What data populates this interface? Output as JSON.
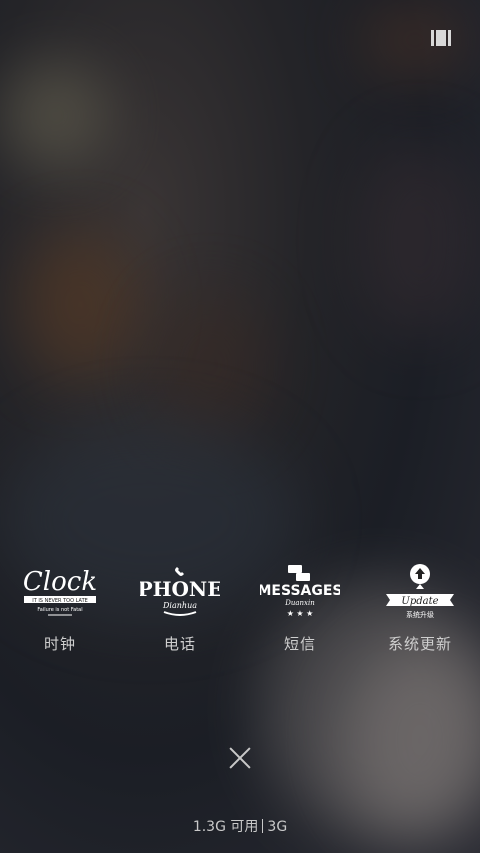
{
  "top_bar": {
    "icon": "card-switch-icon"
  },
  "apps": [
    {
      "name": "clock",
      "label": "时钟",
      "logo_text": "Clock",
      "logo_line1": "IT IS NEVER TOO LATE",
      "logo_line2": "Failure is not Fatal"
    },
    {
      "name": "phone",
      "label": "电话",
      "logo_text": "PHONE",
      "logo_sub": "Dianhua"
    },
    {
      "name": "messages",
      "label": "短信",
      "logo_text": "MESSAGES",
      "logo_sub": "Duanxin"
    },
    {
      "name": "update",
      "label": "系统更新",
      "logo_text": "Update",
      "logo_sub": "系统升级"
    }
  ],
  "close_icon": "close-icon",
  "status": {
    "memory": "1.3G 可用",
    "network": "3G"
  }
}
